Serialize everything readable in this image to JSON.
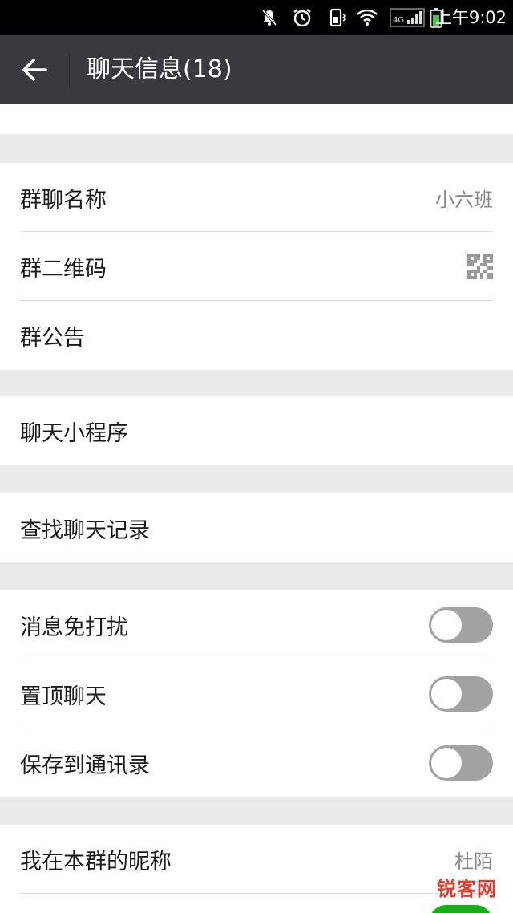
{
  "status_bar": {
    "time": "上午9:02",
    "network": "4G",
    "icons": [
      "mute-bell-icon",
      "alarm-clock-icon",
      "phone-vibrate-icon",
      "wifi-icon",
      "signal-icon",
      "battery-icon"
    ]
  },
  "header": {
    "title": "聊天信息(18)",
    "back_icon": "arrow-left-icon"
  },
  "group_info": {
    "name_label": "群聊名称",
    "name_value": "小六班",
    "qr_label": "群二维码",
    "notice_label": "群公告"
  },
  "mini_program": {
    "label": "聊天小程序"
  },
  "search": {
    "label": "查找聊天记录"
  },
  "settings": {
    "mute_label": "消息免打扰",
    "mute_on": false,
    "sticky_label": "置顶聊天",
    "sticky_on": false,
    "save_contacts_label": "保存到通讯录",
    "save_contacts_on": false
  },
  "nickname": {
    "label": "我在本群的昵称",
    "value": "杜陌"
  },
  "watermark": {
    "text": "锐客网"
  },
  "colors": {
    "header_bg": "#393a3f",
    "toggle_off": "#a3a3a3",
    "toggle_on": "#1aad19",
    "page_bg": "#ebebeb"
  }
}
